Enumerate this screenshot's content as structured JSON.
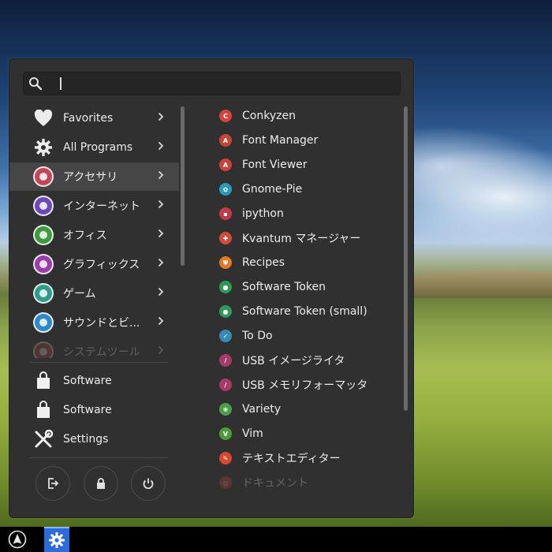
{
  "search": {
    "value": "",
    "placeholder": ""
  },
  "categories": [
    {
      "label": "Favorites",
      "icon": "heart-icon",
      "color": "#e6e6e6"
    },
    {
      "label": "All Programs",
      "icon": "gear-icon",
      "color": "#e6e6e6"
    },
    {
      "label": "アクセサリ",
      "icon": "accessories-icon",
      "color": "#c0475a"
    },
    {
      "label": "インターネット",
      "icon": "internet-icon",
      "color": "#6b49b8"
    },
    {
      "label": "オフィス",
      "icon": "office-icon",
      "color": "#3f9a3f"
    },
    {
      "label": "グラフィックス",
      "icon": "graphics-icon",
      "color": "#9b3fa8"
    },
    {
      "label": "ゲーム",
      "icon": "games-icon",
      "color": "#2f9c8a"
    },
    {
      "label": "サウンドとビ...",
      "icon": "multimedia-icon",
      "color": "#2f88c8"
    },
    {
      "label": "システムツール",
      "icon": "system-tools-icon",
      "color": "#b04040"
    }
  ],
  "favorites": [
    {
      "label": "Software",
      "icon": "software-bag-icon"
    },
    {
      "label": "Software",
      "icon": "software-bag-icon"
    },
    {
      "label": "Settings",
      "icon": "settings-tools-icon"
    }
  ],
  "power": [
    {
      "name": "logout-button",
      "icon": "logout-icon"
    },
    {
      "name": "lock-button",
      "icon": "lock-icon"
    },
    {
      "name": "power-button",
      "icon": "power-icon"
    }
  ],
  "apps": [
    {
      "label": "Conkyzen",
      "icon": "conkyzen-icon",
      "color": "#d3443a",
      "glyph": "C"
    },
    {
      "label": "Font Manager",
      "icon": "font-manager-icon",
      "color": "#c94338",
      "glyph": "A"
    },
    {
      "label": "Font Viewer",
      "icon": "font-viewer-icon",
      "color": "#c94338",
      "glyph": "A"
    },
    {
      "label": "Gnome-Pie",
      "icon": "gnome-pie-icon",
      "color": "#2e9ab8",
      "glyph": "✿"
    },
    {
      "label": "ipython",
      "icon": "ipython-icon",
      "color": "#c53a4a",
      "glyph": "▪"
    },
    {
      "label": "Kvantum マネージャー",
      "icon": "kvantum-icon",
      "color": "#d14a3a",
      "glyph": "✚"
    },
    {
      "label": "Recipes",
      "icon": "recipes-icon",
      "color": "#e07a28",
      "glyph": "Ψ"
    },
    {
      "label": "Software Token",
      "icon": "software-token-icon",
      "color": "#2e9a5a",
      "glyph": "●"
    },
    {
      "label": "Software Token (small)",
      "icon": "software-token-small-icon",
      "color": "#2e9a5a",
      "glyph": "●"
    },
    {
      "label": "To Do",
      "icon": "todo-icon",
      "color": "#3a8ab8",
      "glyph": "✓"
    },
    {
      "label": "USB イメージライタ",
      "icon": "usb-image-writer-icon",
      "color": "#a83a6a",
      "glyph": "/"
    },
    {
      "label": "USB メモリフォーマッタ",
      "icon": "usb-formatter-icon",
      "color": "#a83a6a",
      "glyph": "/"
    },
    {
      "label": "Variety",
      "icon": "variety-icon",
      "color": "#4aa04a",
      "glyph": "❀"
    },
    {
      "label": "Vim",
      "icon": "vim-icon",
      "color": "#4f9a3a",
      "glyph": "V"
    },
    {
      "label": "テキストエディター",
      "icon": "text-editor-icon",
      "color": "#d8482e",
      "glyph": "✎"
    },
    {
      "label": "ドキュメント",
      "icon": "document-icon",
      "color": "#c94338",
      "glyph": "◎"
    }
  ],
  "taskbar": {
    "items": [
      {
        "icon": "arch-logo-icon"
      },
      {
        "icon": "settings-gear-icon"
      }
    ]
  }
}
